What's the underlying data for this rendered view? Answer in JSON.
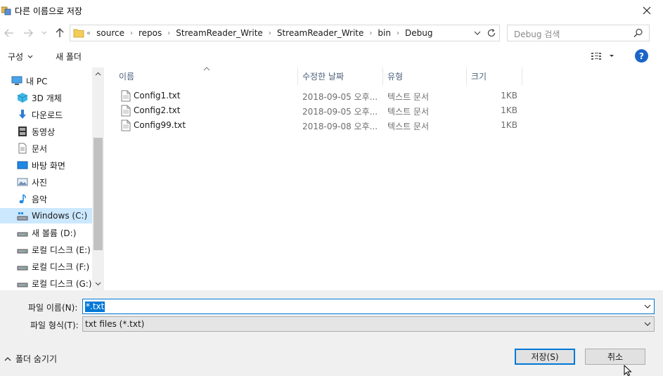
{
  "window": {
    "title": "다른 이름으로 저장"
  },
  "address": {
    "overflow": "«",
    "crumbs": [
      "source",
      "repos",
      "StreamReader_Write",
      "StreamReader_Write",
      "bin",
      "Debug"
    ]
  },
  "search": {
    "placeholder": "Debug 검색"
  },
  "toolbar": {
    "organize": "구성",
    "new_folder": "새 폴더",
    "help": "?"
  },
  "sidebar": {
    "items": [
      {
        "label": "내 PC",
        "icon": "pc-icon"
      },
      {
        "label": "3D 개체",
        "icon": "3d-objects-icon"
      },
      {
        "label": "다운로드",
        "icon": "download-icon"
      },
      {
        "label": "동영상",
        "icon": "video-icon"
      },
      {
        "label": "문서",
        "icon": "document-icon"
      },
      {
        "label": "바탕 화면",
        "icon": "desktop-icon"
      },
      {
        "label": "사진",
        "icon": "pictures-icon"
      },
      {
        "label": "음악",
        "icon": "music-icon"
      },
      {
        "label": "Windows (C:)",
        "icon": "drive-icon"
      },
      {
        "label": "새 볼륨 (D:)",
        "icon": "drive-icon"
      },
      {
        "label": "로컬 디스크 (E:)",
        "icon": "drive-icon"
      },
      {
        "label": "로컬 디스크 (F:)",
        "icon": "drive-icon"
      },
      {
        "label": "로컬 디스크 (G:)",
        "icon": "drive-icon"
      }
    ]
  },
  "columns": {
    "name": "이름",
    "date": "수정한 날짜",
    "type": "유형",
    "size": "크기"
  },
  "files": [
    {
      "name": "Config1.txt",
      "date": "2018-09-05 오후...",
      "type": "텍스트 문서",
      "size": "1KB"
    },
    {
      "name": "Config2.txt",
      "date": "2018-09-05 오후...",
      "type": "텍스트 문서",
      "size": "1KB"
    },
    {
      "name": "Config99.txt",
      "date": "2018-09-08 오후...",
      "type": "텍스트 문서",
      "size": "1KB"
    }
  ],
  "form": {
    "filename_label": "파일 이름(N):",
    "filename_value": "*.txt",
    "filetype_label": "파일 형식(T):",
    "filetype_value": "txt files (*.txt)",
    "hide_folders": "폴더 숨기기",
    "save": "저장(S)",
    "cancel": "취소"
  },
  "colors": {
    "accent": "#0078d7",
    "selection": "#cce8ff",
    "help": "#1c64c8"
  }
}
